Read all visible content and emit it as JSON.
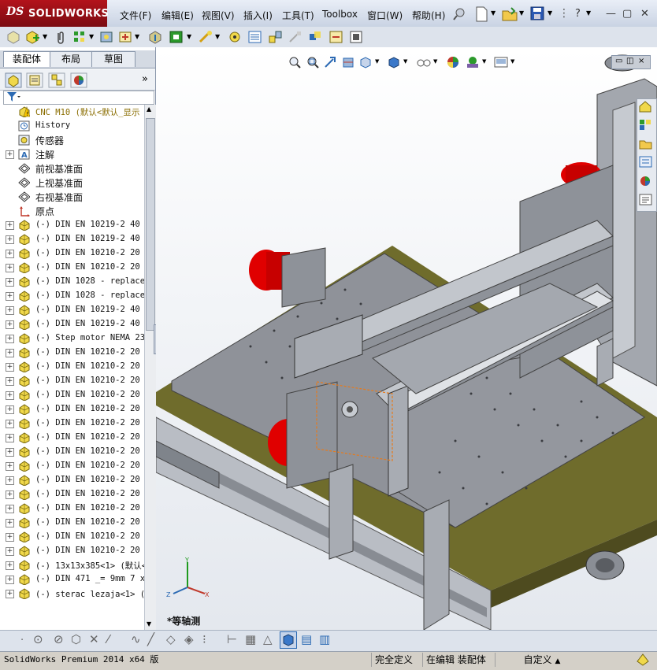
{
  "app": {
    "logo_ds": "DS",
    "logo_name": "SOLIDWORKS"
  },
  "menu": {
    "items": [
      "文件(F)",
      "编辑(E)",
      "视图(V)",
      "插入(I)",
      "工具(T)",
      "Toolbox",
      "窗口(W)",
      "帮助(H)"
    ]
  },
  "window_controls": {
    "help": "?",
    "minimize": "—",
    "restore": "▢",
    "close": "✕"
  },
  "left_panel": {
    "tabs": [
      "装配体",
      "布局",
      "草图"
    ],
    "active_tab": "装配体",
    "expand_arrow": "»",
    "tree": [
      {
        "label": "CNC M10  (默认<默认_显示",
        "icon": "assembly-icon",
        "expand": "",
        "cn": false,
        "highlight": true
      },
      {
        "label": "History",
        "icon": "history-icon",
        "expand": "",
        "cn": false
      },
      {
        "label": "传感器",
        "icon": "sensor-icon",
        "expand": "",
        "cn": true
      },
      {
        "label": "注解",
        "icon": "annotation-icon",
        "expand": "+",
        "cn": true
      },
      {
        "label": "前视基准面",
        "icon": "plane-icon",
        "expand": "",
        "cn": true
      },
      {
        "label": "上视基准面",
        "icon": "plane-icon",
        "expand": "",
        "cn": true
      },
      {
        "label": "右视基准面",
        "icon": "plane-icon",
        "expand": "",
        "cn": true
      },
      {
        "label": "原点",
        "icon": "origin-icon",
        "expand": "",
        "cn": true
      },
      {
        "label": "(-) DIN EN 10219-2 40 x",
        "icon": "part-icon",
        "expand": "+",
        "cn": false
      },
      {
        "label": "(-) DIN EN 10219-2 40 x",
        "icon": "part-icon",
        "expand": "+",
        "cn": false
      },
      {
        "label": "(-) DIN EN 10210-2 20 x",
        "icon": "part-icon",
        "expand": "+",
        "cn": false
      },
      {
        "label": "(-) DIN EN 10210-2 20 x",
        "icon": "part-icon",
        "expand": "+",
        "cn": false
      },
      {
        "label": "(-) DIN 1028 - replaced",
        "icon": "part-icon",
        "expand": "+",
        "cn": false
      },
      {
        "label": "(-) DIN 1028 - replaced",
        "icon": "part-icon",
        "expand": "+",
        "cn": false
      },
      {
        "label": "(-) DIN EN 10219-2 40 x",
        "icon": "part-icon",
        "expand": "+",
        "cn": false
      },
      {
        "label": "(-) DIN EN 10219-2 40 x",
        "icon": "part-icon",
        "expand": "+",
        "cn": false
      },
      {
        "label": "(-) Step motor NEMA 23<",
        "icon": "part-icon",
        "expand": "+",
        "cn": false
      },
      {
        "label": "(-) DIN EN 10210-2 20 x",
        "icon": "part-icon",
        "expand": "+",
        "cn": false
      },
      {
        "label": "(-) DIN EN 10210-2 20 x",
        "icon": "part-icon",
        "expand": "+",
        "cn": false
      },
      {
        "label": "(-) DIN EN 10210-2 20 x",
        "icon": "part-icon",
        "expand": "+",
        "cn": false
      },
      {
        "label": "(-) DIN EN 10210-2 20 x",
        "icon": "part-icon",
        "expand": "+",
        "cn": false
      },
      {
        "label": "(-) DIN EN 10210-2 20 x",
        "icon": "part-icon",
        "expand": "+",
        "cn": false
      },
      {
        "label": "(-) DIN EN 10210-2 20 x",
        "icon": "part-icon",
        "expand": "+",
        "cn": false
      },
      {
        "label": "(-) DIN EN 10210-2 20 x",
        "icon": "part-icon",
        "expand": "+",
        "cn": false
      },
      {
        "label": "(-) DIN EN 10210-2 20 x",
        "icon": "part-icon",
        "expand": "+",
        "cn": false
      },
      {
        "label": "(-) DIN EN 10210-2 20 x",
        "icon": "part-icon",
        "expand": "+",
        "cn": false
      },
      {
        "label": "(-) DIN EN 10210-2 20 x",
        "icon": "part-icon",
        "expand": "+",
        "cn": false
      },
      {
        "label": "(-) DIN EN 10210-2 20 x",
        "icon": "part-icon",
        "expand": "+",
        "cn": false
      },
      {
        "label": "(-) DIN EN 10210-2 20 x",
        "icon": "part-icon",
        "expand": "+",
        "cn": false
      },
      {
        "label": "(-) DIN EN 10210-2 20 x",
        "icon": "part-icon",
        "expand": "+",
        "cn": false
      },
      {
        "label": "(-) DIN EN 10210-2 20 x",
        "icon": "part-icon",
        "expand": "+",
        "cn": false
      },
      {
        "label": "(-) DIN EN 10210-2 20 x",
        "icon": "part-icon",
        "expand": "+",
        "cn": false
      },
      {
        "label": "(-) 13x13x385<1> (默认<",
        "icon": "part-icon",
        "expand": "+",
        "cn": false
      },
      {
        "label": "(-) DIN 471  _= 9mm 7 x",
        "icon": "part-icon",
        "expand": "+",
        "cn": false
      },
      {
        "label": "(-) sterac lezaja<1> (默",
        "icon": "part-icon",
        "expand": "+",
        "cn": false
      }
    ]
  },
  "viewport": {
    "view_name": "*等轴测",
    "triad_axes": [
      "X",
      "Y",
      "Z"
    ]
  },
  "status": {
    "product": "SolidWorks Premium 2014 x64 版",
    "definition": "完全定义",
    "editing": "在编辑 装配体",
    "units": "自定义",
    "units_arrow": "▲"
  },
  "colors": {
    "motor_red": "#e00000",
    "frame_gray": "#9a9ea6",
    "table_plate": "#8c8f96",
    "base_olive": "#6e6b2e",
    "selection_orange": "#e87a1a",
    "logo_red": "#b3131b"
  }
}
